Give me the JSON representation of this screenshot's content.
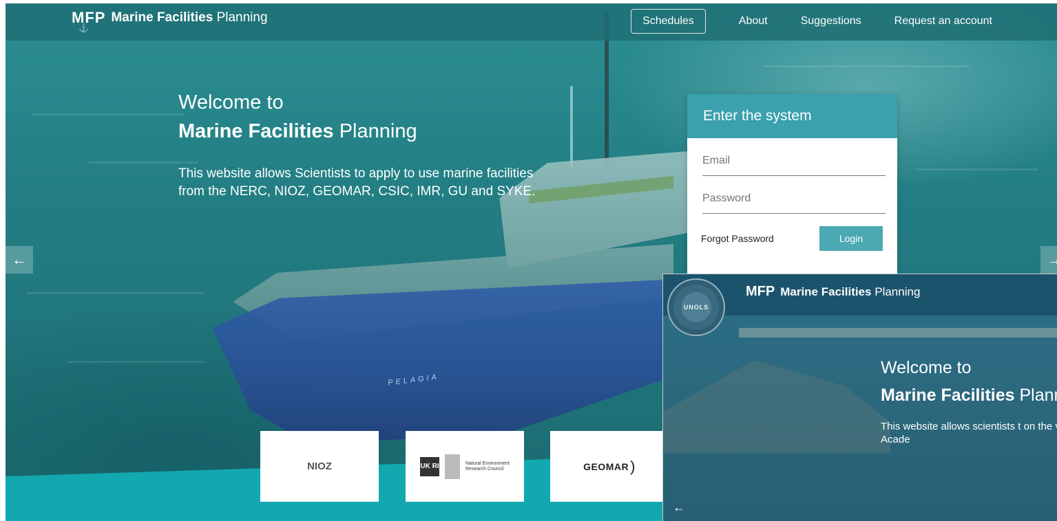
{
  "brand": {
    "mark": "MFP",
    "name_bold": "Marine Facilities",
    "name_rest": "Planning"
  },
  "nav": {
    "schedules": "Schedules",
    "about": "About",
    "suggestions": "Suggestions",
    "request": "Request an account"
  },
  "hero": {
    "welcome": "Welcome to",
    "title_bold": "Marine Facilities",
    "title_rest": "Planning",
    "description": "This website allows Scientists to apply to use marine facilities from the NERC, NIOZ, GEOMAR, CSIC, IMR, GU and SYKE.",
    "ship_name": "PELAGIA"
  },
  "login": {
    "heading": "Enter the system",
    "email_placeholder": "Email",
    "password_placeholder": "Password",
    "forgot": "Forgot Password",
    "button": "Login"
  },
  "partners": {
    "nioz": "NIOZ",
    "ukri_mark": "UK RI",
    "nerc": "Natural Environment Research Council",
    "geomar": "GEOMAR"
  },
  "icons": {
    "prev": "arrow-left-icon",
    "next": "arrow-right-icon"
  },
  "inset": {
    "seal_text": "UNOLS",
    "brand_mark": "MFP",
    "brand_bold": "Marine Facilities",
    "brand_rest": "Planning",
    "welcome": "Welcome to",
    "title_bold": "Marine Facilities",
    "title_rest": "Plann",
    "description": "This website allows scientists t on the vessels of the U.S. Acade"
  },
  "colors": {
    "nav_bg": "#1e6e73",
    "login_header": "#3aa1ad",
    "login_button": "#4ba9b3",
    "strip": "#13a8b0"
  }
}
